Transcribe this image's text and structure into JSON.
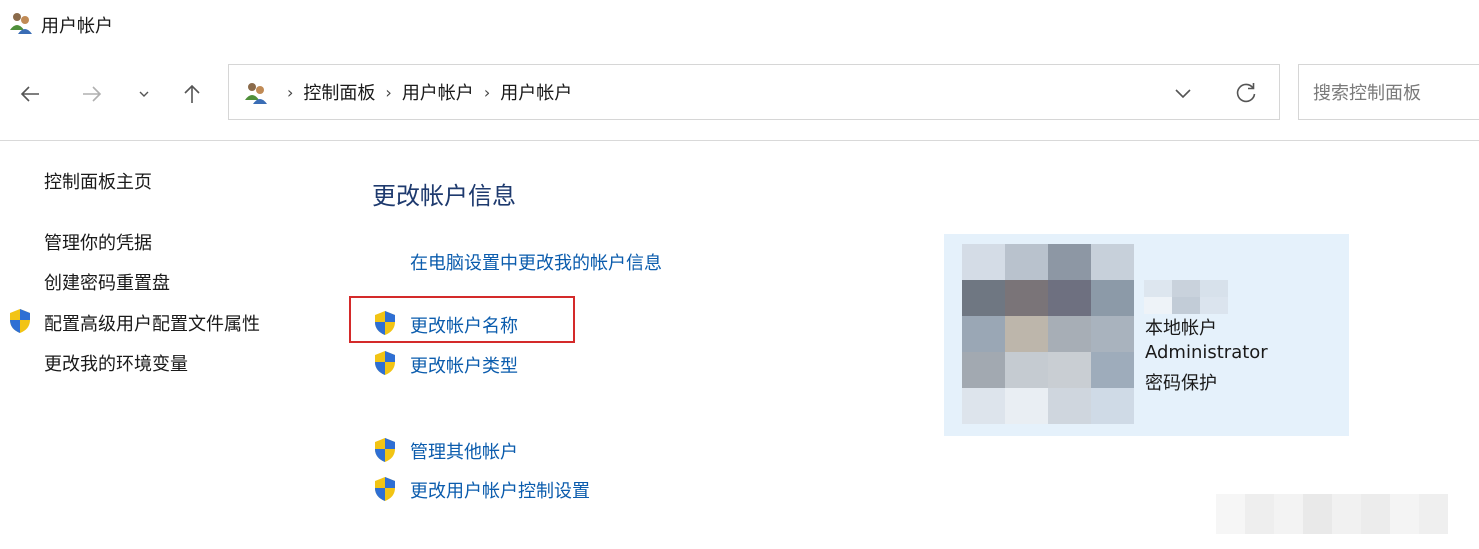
{
  "window": {
    "title": "用户帐户",
    "icon": "user-accounts-icon"
  },
  "navigation": {
    "back_icon": "arrow-left-icon",
    "forward_icon": "arrow-right-icon",
    "recent_icon": "chevron-down-icon",
    "up_icon": "arrow-up-icon"
  },
  "address_bar": {
    "icon": "user-accounts-icon",
    "breadcrumbs": [
      "控制面板",
      "用户帐户",
      "用户帐户"
    ],
    "separator": "›",
    "dropdown_icon": "chevron-down-icon",
    "refresh_icon": "refresh-icon"
  },
  "search": {
    "placeholder": "搜索控制面板",
    "value": ""
  },
  "sidebar": {
    "items": [
      {
        "label": "控制面板主页",
        "shield": false
      },
      {
        "label": "管理你的凭据",
        "shield": false
      },
      {
        "label": "创建密码重置盘",
        "shield": false
      },
      {
        "label": "配置高级用户配置文件属性",
        "shield": true
      },
      {
        "label": "更改我的环境变量",
        "shield": false
      }
    ]
  },
  "main": {
    "title": "更改帐户信息",
    "links": [
      {
        "label": "在电脑设置中更改我的帐户信息",
        "shield": false
      },
      {
        "label": "更改帐户名称",
        "shield": true,
        "highlighted": true
      },
      {
        "label": "更改帐户类型",
        "shield": true
      },
      {
        "label": "管理其他帐户",
        "shield": true
      },
      {
        "label": "更改用户帐户控制设置",
        "shield": true
      }
    ],
    "highlight_color": "#d42a2a",
    "link_color": "#0b5cad",
    "title_color": "#1e3a6e"
  },
  "account": {
    "type": "本地帐户",
    "role": "Administrator",
    "status": "密码保护",
    "card_color": "#e5f1fb",
    "avatar": "pixelated-avatar",
    "name_obscured": true
  }
}
